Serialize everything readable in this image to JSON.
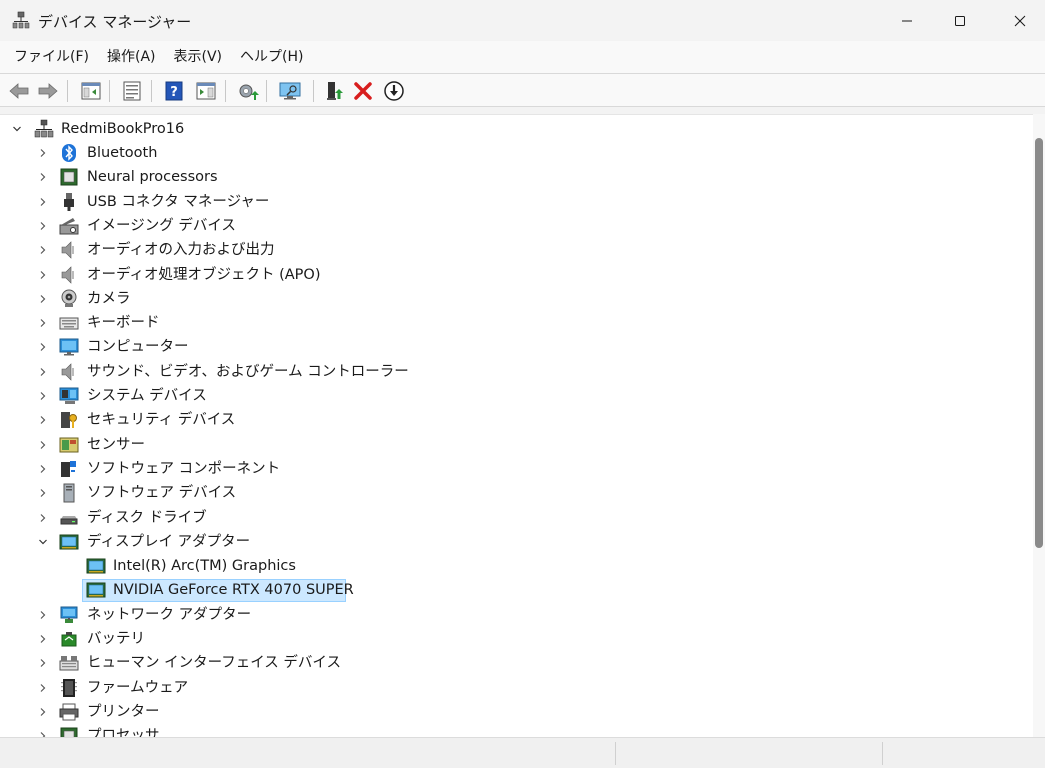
{
  "window": {
    "title": "デバイス マネージャー",
    "icon": "device-manager-icon"
  },
  "menu": [
    {
      "label": "ファイル(F)"
    },
    {
      "label": "操作(A)"
    },
    {
      "label": "表示(V)"
    },
    {
      "label": "ヘルプ(H)"
    }
  ],
  "toolbar": {
    "buttons": [
      "back-arrow-icon",
      "forward-arrow-icon",
      "show-hide-console-tree-icon",
      "properties-icon",
      "help-icon",
      "action-pane-icon",
      "update-driver-icon",
      "scan-hardware-icon",
      "enable-device-icon",
      "uninstall-device-icon",
      "disable-device-icon"
    ]
  },
  "tree": {
    "root": "RedmiBookPro16",
    "items": [
      {
        "label": "Bluetooth",
        "icon": "bluetooth-icon"
      },
      {
        "label": "Neural processors",
        "icon": "chip-icon"
      },
      {
        "label": "USB コネクタ マネージャー",
        "icon": "usb-connector-icon"
      },
      {
        "label": "イメージング デバイス",
        "icon": "imaging-device-icon"
      },
      {
        "label": "オーディオの入力および出力",
        "icon": "speaker-icon"
      },
      {
        "label": "オーディオ処理オブジェクト (APO)",
        "icon": "speaker-icon"
      },
      {
        "label": "カメラ",
        "icon": "camera-icon"
      },
      {
        "label": "キーボード",
        "icon": "keyboard-icon"
      },
      {
        "label": "コンピューター",
        "icon": "monitor-icon"
      },
      {
        "label": "サウンド、ビデオ、およびゲーム コントローラー",
        "icon": "speaker-icon"
      },
      {
        "label": "システム デバイス",
        "icon": "system-device-icon"
      },
      {
        "label": "セキュリティ デバイス",
        "icon": "security-key-icon"
      },
      {
        "label": "センサー",
        "icon": "sensor-icon"
      },
      {
        "label": "ソフトウェア コンポーネント",
        "icon": "software-component-icon"
      },
      {
        "label": "ソフトウェア デバイス",
        "icon": "software-device-icon"
      },
      {
        "label": "ディスク ドライブ",
        "icon": "disk-drive-icon"
      },
      {
        "label": "ディスプレイ アダプター",
        "icon": "display-adapter-icon",
        "expanded": true,
        "children": [
          {
            "label": "Intel(R) Arc(TM) Graphics",
            "icon": "display-adapter-icon"
          },
          {
            "label": "NVIDIA GeForce RTX 4070 SUPER",
            "icon": "display-adapter-icon",
            "selected": true
          }
        ]
      },
      {
        "label": "ネットワーク アダプター",
        "icon": "network-adapter-icon"
      },
      {
        "label": "バッテリ",
        "icon": "battery-icon"
      },
      {
        "label": "ヒューマン インターフェイス デバイス",
        "icon": "hid-icon"
      },
      {
        "label": "ファームウェア",
        "icon": "firmware-icon"
      },
      {
        "label": "プリンター",
        "icon": "printer-icon"
      },
      {
        "label": "プロセッサ",
        "icon": "processor-icon"
      }
    ]
  },
  "colors": {
    "selection_bg": "#cce8ff",
    "selection_border": "#99d1ff",
    "window_bg": "#f3f3f3"
  }
}
